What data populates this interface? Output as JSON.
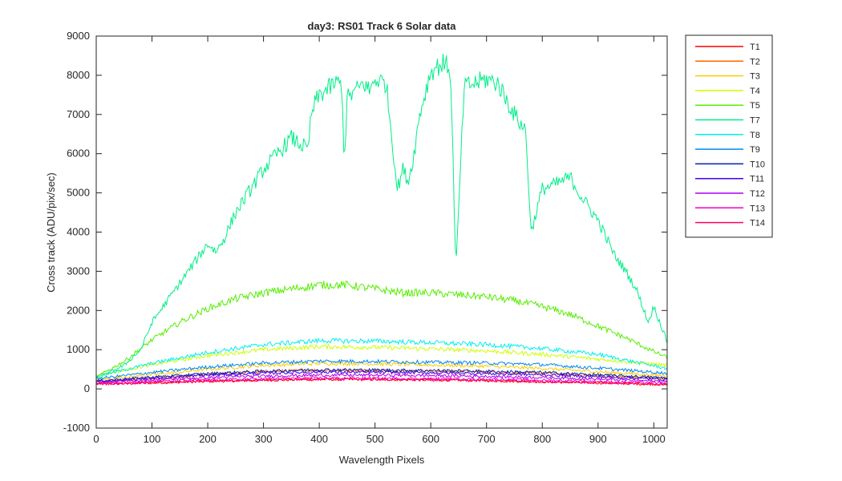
{
  "chart_data": {
    "type": "line",
    "title": "day3: RS01  Track 6 Solar data",
    "xlabel": "Wavelength Pixels",
    "ylabel": "Cross track (ADU/pix/sec)",
    "xlim": [
      0,
      1024
    ],
    "ylim": [
      -1000,
      9000
    ],
    "xticks": [
      0,
      100,
      200,
      300,
      400,
      500,
      600,
      700,
      800,
      900,
      1000
    ],
    "yticks": [
      -1000,
      0,
      1000,
      2000,
      3000,
      4000,
      5000,
      6000,
      7000,
      8000,
      9000
    ],
    "grid": false,
    "legend_position": "outside-right",
    "series": [
      {
        "name": "T1",
        "color": "#ff0000",
        "x": [
          0,
          100,
          200,
          300,
          400,
          500,
          600,
          700,
          800,
          900,
          1024
        ],
        "y": [
          120,
          150,
          190,
          220,
          240,
          240,
          230,
          210,
          180,
          150,
          110
        ]
      },
      {
        "name": "T2",
        "color": "#ff6600",
        "x": [
          0,
          100,
          200,
          300,
          400,
          500,
          600,
          700,
          800,
          900,
          1024
        ],
        "y": [
          180,
          260,
          360,
          440,
          480,
          470,
          450,
          430,
          390,
          330,
          260
        ]
      },
      {
        "name": "T3",
        "color": "#ffcc00",
        "x": [
          0,
          100,
          200,
          300,
          400,
          500,
          600,
          700,
          800,
          900,
          1024
        ],
        "y": [
          230,
          360,
          500,
          600,
          650,
          640,
          610,
          580,
          520,
          440,
          330
        ]
      },
      {
        "name": "T4",
        "color": "#ccff00",
        "x": [
          0,
          100,
          200,
          300,
          400,
          500,
          600,
          700,
          800,
          900,
          1024
        ],
        "y": [
          330,
          620,
          850,
          1000,
          1080,
          1060,
          1020,
          970,
          880,
          760,
          600
        ]
      },
      {
        "name": "T5",
        "color": "#55ee00",
        "x": [
          0,
          50,
          100,
          150,
          200,
          250,
          300,
          350,
          400,
          450,
          500,
          550,
          600,
          650,
          700,
          750,
          800,
          850,
          900,
          950,
          1000,
          1024
        ],
        "y": [
          300,
          700,
          1250,
          1700,
          2050,
          2300,
          2450,
          2550,
          2650,
          2650,
          2550,
          2450,
          2450,
          2400,
          2350,
          2250,
          2100,
          1900,
          1600,
          1300,
          950,
          800
        ]
      },
      {
        "name": "T7",
        "color": "#00ee88",
        "x": [
          0,
          50,
          80,
          100,
          150,
          200,
          215,
          230,
          250,
          300,
          350,
          380,
          385,
          390,
          400,
          430,
          440,
          445,
          450,
          480,
          490,
          500,
          520,
          540,
          550,
          560,
          570,
          580,
          600,
          620,
          635,
          640,
          645,
          650,
          660,
          700,
          720,
          750,
          770,
          780,
          800,
          820,
          850,
          870,
          900,
          930,
          950,
          970,
          990,
          1000,
          1024
        ],
        "y": [
          250,
          600,
          1000,
          1700,
          2700,
          3700,
          3500,
          3850,
          4500,
          5600,
          6400,
          6100,
          6900,
          7200,
          7500,
          7800,
          7800,
          5800,
          7400,
          7800,
          7600,
          7900,
          7800,
          5100,
          5600,
          5300,
          6000,
          7000,
          8100,
          8300,
          8200,
          5800,
          3000,
          4600,
          7700,
          7900,
          7800,
          7000,
          6600,
          4000,
          5100,
          5200,
          5400,
          4900,
          4300,
          3400,
          3000,
          2500,
          1700,
          2100,
          1200
        ]
      },
      {
        "name": "T8",
        "color": "#00eeee",
        "x": [
          0,
          100,
          200,
          300,
          400,
          500,
          600,
          700,
          800,
          900,
          1024
        ],
        "y": [
          320,
          650,
          930,
          1130,
          1230,
          1220,
          1180,
          1130,
          1030,
          880,
          520
        ]
      },
      {
        "name": "T9",
        "color": "#0088ee",
        "x": [
          0,
          100,
          200,
          300,
          400,
          500,
          600,
          700,
          800,
          900,
          1024
        ],
        "y": [
          260,
          420,
          560,
          660,
          710,
          700,
          680,
          660,
          620,
          530,
          400
        ]
      },
      {
        "name": "T10",
        "color": "#0022aa",
        "x": [
          0,
          100,
          200,
          300,
          400,
          500,
          600,
          700,
          800,
          900,
          1024
        ],
        "y": [
          200,
          300,
          390,
          450,
          490,
          480,
          470,
          450,
          420,
          360,
          280
        ]
      },
      {
        "name": "T11",
        "color": "#4400ee",
        "x": [
          0,
          100,
          200,
          300,
          400,
          500,
          600,
          700,
          800,
          900,
          1024
        ],
        "y": [
          190,
          270,
          350,
          400,
          430,
          420,
          410,
          390,
          360,
          310,
          240
        ]
      },
      {
        "name": "T12",
        "color": "#aa00ee",
        "x": [
          0,
          100,
          200,
          300,
          400,
          500,
          600,
          700,
          800,
          900,
          1024
        ],
        "y": [
          160,
          230,
          290,
          330,
          350,
          350,
          340,
          320,
          290,
          250,
          190
        ]
      },
      {
        "name": "T13",
        "color": "#ee00cc",
        "x": [
          0,
          100,
          200,
          300,
          400,
          500,
          600,
          700,
          800,
          900,
          1024
        ],
        "y": [
          140,
          190,
          230,
          260,
          280,
          270,
          260,
          250,
          220,
          190,
          150
        ]
      },
      {
        "name": "T14",
        "color": "#ff0066",
        "x": [
          0,
          100,
          200,
          300,
          400,
          500,
          600,
          700,
          800,
          900,
          1024
        ],
        "y": [
          120,
          160,
          200,
          230,
          250,
          240,
          230,
          220,
          190,
          160,
          120
        ]
      }
    ]
  }
}
